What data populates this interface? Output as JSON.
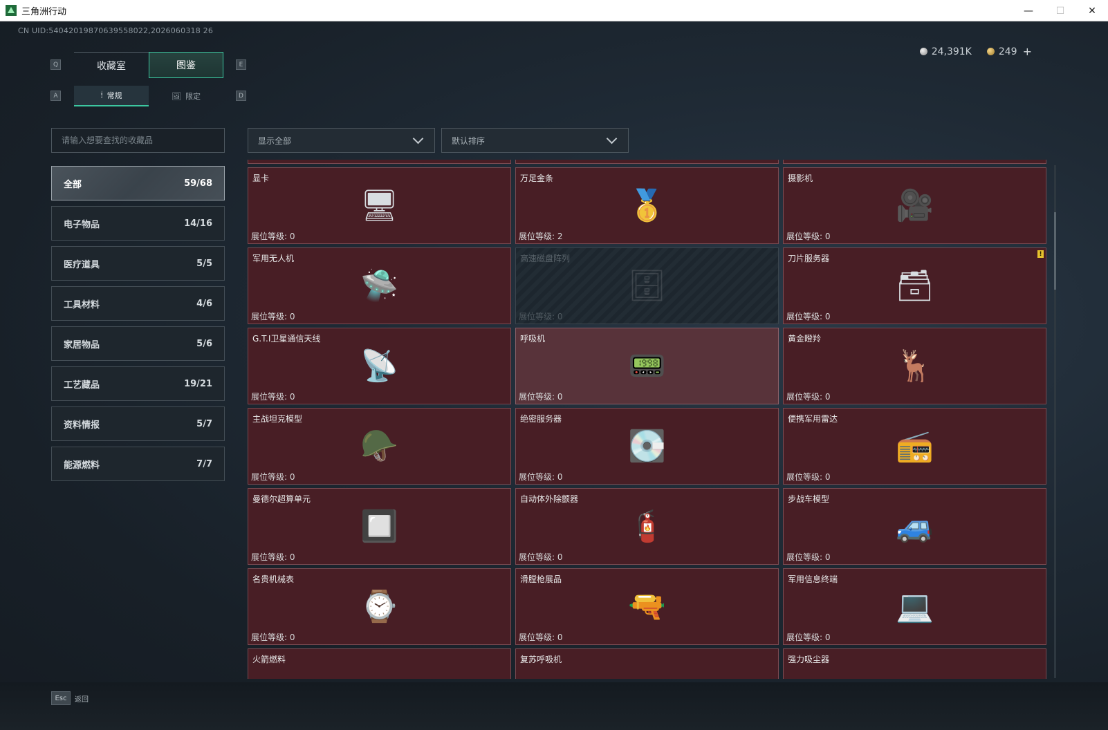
{
  "window": {
    "title": "三角洲行动",
    "minimize": "—",
    "maximize": "☐",
    "close": "✕"
  },
  "header": {
    "uid": "CN UID:5404201987063955802​2,2026060318 26",
    "currency": [
      {
        "icon": "silver-coin-icon",
        "value": "24,391K"
      },
      {
        "icon": "gold-coin-icon",
        "value": "249"
      }
    ],
    "add": "+"
  },
  "keys": {
    "prev_tab": "Q",
    "next_tab": "E",
    "prev_sub": "A",
    "next_sub": "D"
  },
  "tabs": [
    {
      "label": "收藏室",
      "active": false
    },
    {
      "label": "图鉴",
      "active": true
    }
  ],
  "subtabs": [
    {
      "label": "常规",
      "icon": "🕯",
      "active": true
    },
    {
      "label": "限定",
      "icon": "🖼",
      "active": false
    }
  ],
  "search": {
    "placeholder": "请输入想要查找的收藏品"
  },
  "filters": {
    "show": {
      "value": "显示全部"
    },
    "sort": {
      "value": "默认排序"
    }
  },
  "categories": [
    {
      "label": "全部",
      "count": "59/68",
      "active": true
    },
    {
      "label": "电子物品",
      "count": "14/16"
    },
    {
      "label": "医疗道具",
      "count": "5/5"
    },
    {
      "label": "工具材料",
      "count": "4/6"
    },
    {
      "label": "家居物品",
      "count": "5/6"
    },
    {
      "label": "工艺藏品",
      "count": "19/21"
    },
    {
      "label": "资料情报",
      "count": "5/7"
    },
    {
      "label": "能源燃料",
      "count": "7/7"
    }
  ],
  "items": [
    {
      "name": "",
      "level": "",
      "icon": "",
      "state": "partial"
    },
    {
      "name": "",
      "level": "",
      "icon": "",
      "state": "partial"
    },
    {
      "name": "",
      "level": "",
      "icon": "",
      "state": "partial"
    },
    {
      "name": "显卡",
      "level": "展位等级: 0",
      "icon": "🖥",
      "state": "normal"
    },
    {
      "name": "万足金条",
      "level": "展位等级: 2",
      "icon": "🥇",
      "state": "normal"
    },
    {
      "name": "摄影机",
      "level": "展位等级: 0",
      "icon": "🎥",
      "state": "normal"
    },
    {
      "name": "军用无人机",
      "level": "展位等级: 0",
      "icon": "🛸",
      "state": "normal"
    },
    {
      "name": "高速磁盘阵列",
      "level": "展位等级: 0",
      "icon": "🗄",
      "state": "locked"
    },
    {
      "name": "刀片服务器",
      "level": "展位等级: 0",
      "icon": "🗃",
      "state": "normal",
      "alert": "!"
    },
    {
      "name": "G.T.I卫星通信天线",
      "level": "展位等级: 0",
      "icon": "📡",
      "state": "normal"
    },
    {
      "name": "呼吸机",
      "level": "展位等级: 0",
      "icon": "📟",
      "state": "highlight"
    },
    {
      "name": "黄金瞪羚",
      "level": "展位等级: 0",
      "icon": "🦌",
      "state": "normal"
    },
    {
      "name": "主战坦克模型",
      "level": "展位等级: 0",
      "icon": "🪖",
      "state": "normal"
    },
    {
      "name": "绝密服务器",
      "level": "展位等级: 0",
      "icon": "💽",
      "state": "normal"
    },
    {
      "name": "便携军用雷达",
      "level": "展位等级: 0",
      "icon": "📻",
      "state": "normal"
    },
    {
      "name": "曼德尔超算单元",
      "level": "展位等级: 0",
      "icon": "🔲",
      "state": "normal"
    },
    {
      "name": "自动体外除颤器",
      "level": "展位等级: 0",
      "icon": "🧯",
      "state": "normal"
    },
    {
      "name": "步战车模型",
      "level": "展位等级: 0",
      "icon": "🚙",
      "state": "normal"
    },
    {
      "name": "名贵机械表",
      "level": "展位等级: 0",
      "icon": "⌚",
      "state": "normal"
    },
    {
      "name": "滑膛枪展品",
      "level": "展位等级: 0",
      "icon": "🔫",
      "state": "normal"
    },
    {
      "name": "军用信息终端",
      "level": "展位等级: 0",
      "icon": "💻",
      "state": "normal"
    },
    {
      "name": "火箭燃料",
      "level": "",
      "icon": "",
      "state": "partial"
    },
    {
      "name": "复苏呼吸机",
      "level": "",
      "icon": "",
      "state": "partial"
    },
    {
      "name": "强力吸尘器",
      "level": "",
      "icon": "",
      "state": "partial"
    }
  ],
  "footer": {
    "key": "Esc",
    "label": "返回"
  }
}
